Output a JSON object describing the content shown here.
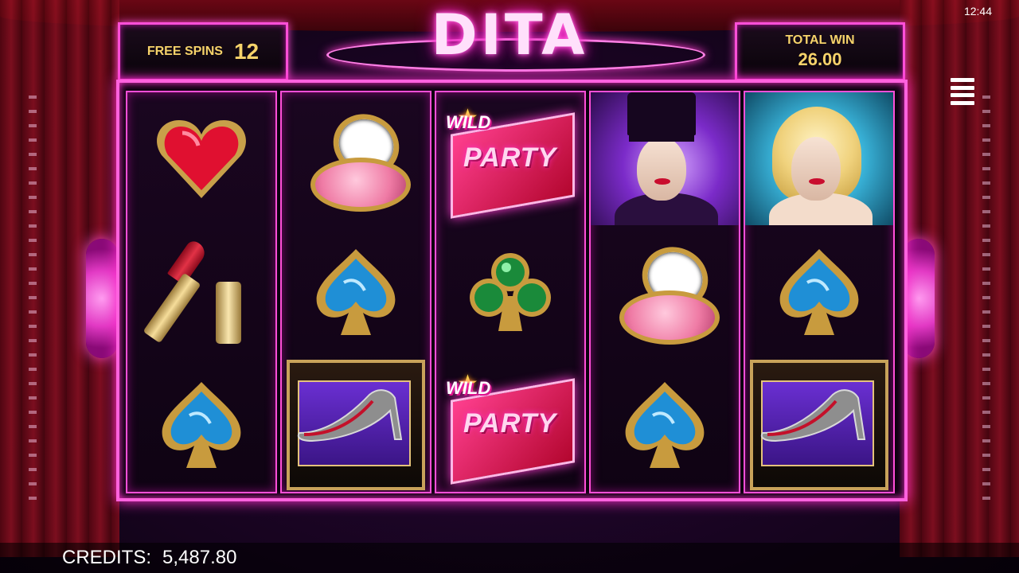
{
  "hud": {
    "free_spins_label": "FREE SPINS",
    "free_spins_value": "12",
    "total_win_label": "TOTAL WIN",
    "total_win_value": "26.00",
    "clock": "12:44"
  },
  "logo": {
    "text": "DITA"
  },
  "reels": [
    [
      "heart-icon",
      "lipstick-icon",
      "blue-spade-icon"
    ],
    [
      "powder-compact-icon",
      "blue-spade-icon",
      "stiletto-shoe-icon"
    ],
    [
      "wild-party-icon",
      "green-club-icon",
      "wild-party-icon"
    ],
    [
      "top-hat-lady-portrait",
      "powder-compact-icon",
      "blue-spade-icon"
    ],
    [
      "blonde-lady-portrait",
      "blue-spade-icon",
      "stiletto-shoe-icon"
    ]
  ],
  "wild": {
    "word1": "WILD",
    "word2": "PARTY"
  },
  "credits": {
    "label": "CREDITS:",
    "value": "5,487.80"
  },
  "colors": {
    "accent": "#ff4fd8",
    "gold": "#f6d36a"
  }
}
